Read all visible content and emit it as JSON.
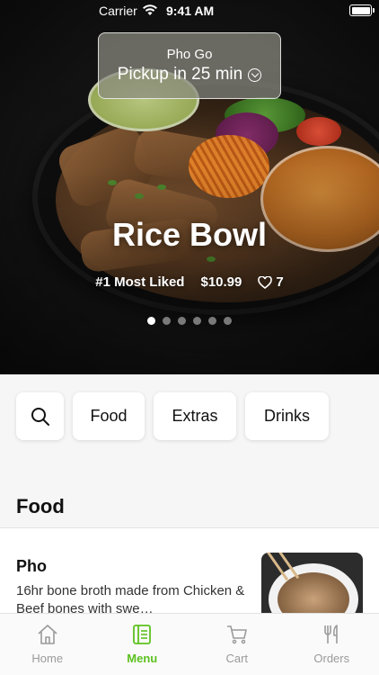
{
  "status_bar": {
    "carrier": "Carrier",
    "time": "9:41 AM"
  },
  "pickup": {
    "store": "Pho Go",
    "time_label": "Pickup in 25 min"
  },
  "hero": {
    "title": "Rice Bowl",
    "rank": "#1 Most Liked",
    "price": "$10.99",
    "likes": "7",
    "carousel_pages": 6,
    "carousel_active": 1
  },
  "chips": [
    {
      "icon": "search-icon"
    },
    {
      "label": "Food"
    },
    {
      "label": "Extras"
    },
    {
      "label": "Drinks"
    }
  ],
  "section": {
    "title": "Food"
  },
  "items": [
    {
      "name": "Pho",
      "description": "16hr bone broth made from Chicken & Beef bones with swe…"
    }
  ],
  "tabs": [
    {
      "label": "Home",
      "icon": "home-icon",
      "active": false
    },
    {
      "label": "Menu",
      "icon": "menu-book-icon",
      "active": true
    },
    {
      "label": "Cart",
      "icon": "cart-icon",
      "active": false
    },
    {
      "label": "Orders",
      "icon": "fork-knife-icon",
      "active": false
    }
  ],
  "colors": {
    "accent": "#5cc11f",
    "inactive": "#9a9a9a",
    "background": "#f6f6f6"
  }
}
